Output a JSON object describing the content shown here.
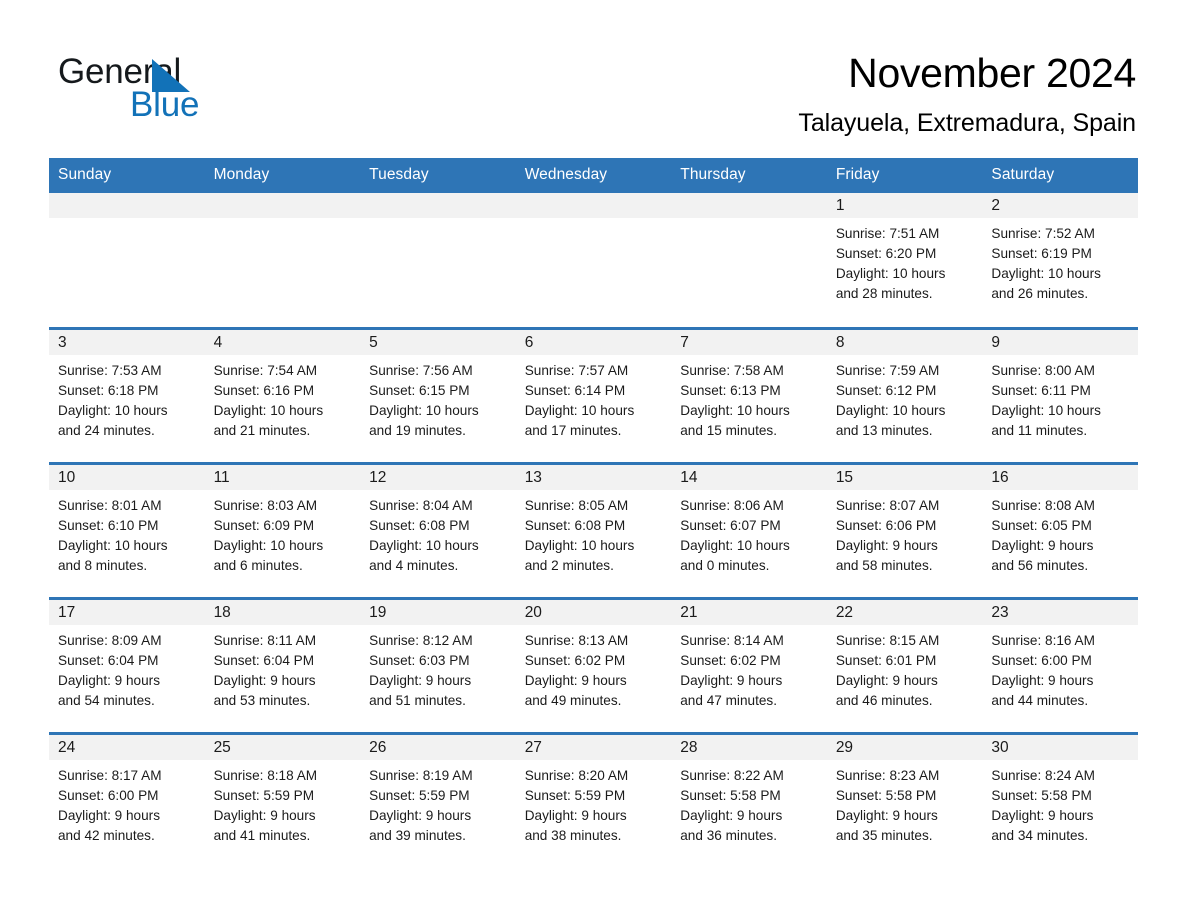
{
  "brand": {
    "name_part1": "General",
    "name_part2": "Blue",
    "accent_color": "#1272b8"
  },
  "header": {
    "title": "November 2024",
    "subtitle": "Talayuela, Extremadura, Spain"
  },
  "theme": {
    "header_bg": "#2e75b6",
    "daynum_bg": "#f2f2f2",
    "page_bg": "#ffffff",
    "text": "#1b1b1b"
  },
  "weekdays": [
    "Sunday",
    "Monday",
    "Tuesday",
    "Wednesday",
    "Thursday",
    "Friday",
    "Saturday"
  ],
  "weeks": [
    [
      {
        "day": "",
        "sunrise": "",
        "sunset": "",
        "daylight1": "",
        "daylight2": ""
      },
      {
        "day": "",
        "sunrise": "",
        "sunset": "",
        "daylight1": "",
        "daylight2": ""
      },
      {
        "day": "",
        "sunrise": "",
        "sunset": "",
        "daylight1": "",
        "daylight2": ""
      },
      {
        "day": "",
        "sunrise": "",
        "sunset": "",
        "daylight1": "",
        "daylight2": ""
      },
      {
        "day": "",
        "sunrise": "",
        "sunset": "",
        "daylight1": "",
        "daylight2": ""
      },
      {
        "day": "1",
        "sunrise": "Sunrise: 7:51 AM",
        "sunset": "Sunset: 6:20 PM",
        "daylight1": "Daylight: 10 hours",
        "daylight2": "and 28 minutes."
      },
      {
        "day": "2",
        "sunrise": "Sunrise: 7:52 AM",
        "sunset": "Sunset: 6:19 PM",
        "daylight1": "Daylight: 10 hours",
        "daylight2": "and 26 minutes."
      }
    ],
    [
      {
        "day": "3",
        "sunrise": "Sunrise: 7:53 AM",
        "sunset": "Sunset: 6:18 PM",
        "daylight1": "Daylight: 10 hours",
        "daylight2": "and 24 minutes."
      },
      {
        "day": "4",
        "sunrise": "Sunrise: 7:54 AM",
        "sunset": "Sunset: 6:16 PM",
        "daylight1": "Daylight: 10 hours",
        "daylight2": "and 21 minutes."
      },
      {
        "day": "5",
        "sunrise": "Sunrise: 7:56 AM",
        "sunset": "Sunset: 6:15 PM",
        "daylight1": "Daylight: 10 hours",
        "daylight2": "and 19 minutes."
      },
      {
        "day": "6",
        "sunrise": "Sunrise: 7:57 AM",
        "sunset": "Sunset: 6:14 PM",
        "daylight1": "Daylight: 10 hours",
        "daylight2": "and 17 minutes."
      },
      {
        "day": "7",
        "sunrise": "Sunrise: 7:58 AM",
        "sunset": "Sunset: 6:13 PM",
        "daylight1": "Daylight: 10 hours",
        "daylight2": "and 15 minutes."
      },
      {
        "day": "8",
        "sunrise": "Sunrise: 7:59 AM",
        "sunset": "Sunset: 6:12 PM",
        "daylight1": "Daylight: 10 hours",
        "daylight2": "and 13 minutes."
      },
      {
        "day": "9",
        "sunrise": "Sunrise: 8:00 AM",
        "sunset": "Sunset: 6:11 PM",
        "daylight1": "Daylight: 10 hours",
        "daylight2": "and 11 minutes."
      }
    ],
    [
      {
        "day": "10",
        "sunrise": "Sunrise: 8:01 AM",
        "sunset": "Sunset: 6:10 PM",
        "daylight1": "Daylight: 10 hours",
        "daylight2": "and 8 minutes."
      },
      {
        "day": "11",
        "sunrise": "Sunrise: 8:03 AM",
        "sunset": "Sunset: 6:09 PM",
        "daylight1": "Daylight: 10 hours",
        "daylight2": "and 6 minutes."
      },
      {
        "day": "12",
        "sunrise": "Sunrise: 8:04 AM",
        "sunset": "Sunset: 6:08 PM",
        "daylight1": "Daylight: 10 hours",
        "daylight2": "and 4 minutes."
      },
      {
        "day": "13",
        "sunrise": "Sunrise: 8:05 AM",
        "sunset": "Sunset: 6:08 PM",
        "daylight1": "Daylight: 10 hours",
        "daylight2": "and 2 minutes."
      },
      {
        "day": "14",
        "sunrise": "Sunrise: 8:06 AM",
        "sunset": "Sunset: 6:07 PM",
        "daylight1": "Daylight: 10 hours",
        "daylight2": "and 0 minutes."
      },
      {
        "day": "15",
        "sunrise": "Sunrise: 8:07 AM",
        "sunset": "Sunset: 6:06 PM",
        "daylight1": "Daylight: 9 hours",
        "daylight2": "and 58 minutes."
      },
      {
        "day": "16",
        "sunrise": "Sunrise: 8:08 AM",
        "sunset": "Sunset: 6:05 PM",
        "daylight1": "Daylight: 9 hours",
        "daylight2": "and 56 minutes."
      }
    ],
    [
      {
        "day": "17",
        "sunrise": "Sunrise: 8:09 AM",
        "sunset": "Sunset: 6:04 PM",
        "daylight1": "Daylight: 9 hours",
        "daylight2": "and 54 minutes."
      },
      {
        "day": "18",
        "sunrise": "Sunrise: 8:11 AM",
        "sunset": "Sunset: 6:04 PM",
        "daylight1": "Daylight: 9 hours",
        "daylight2": "and 53 minutes."
      },
      {
        "day": "19",
        "sunrise": "Sunrise: 8:12 AM",
        "sunset": "Sunset: 6:03 PM",
        "daylight1": "Daylight: 9 hours",
        "daylight2": "and 51 minutes."
      },
      {
        "day": "20",
        "sunrise": "Sunrise: 8:13 AM",
        "sunset": "Sunset: 6:02 PM",
        "daylight1": "Daylight: 9 hours",
        "daylight2": "and 49 minutes."
      },
      {
        "day": "21",
        "sunrise": "Sunrise: 8:14 AM",
        "sunset": "Sunset: 6:02 PM",
        "daylight1": "Daylight: 9 hours",
        "daylight2": "and 47 minutes."
      },
      {
        "day": "22",
        "sunrise": "Sunrise: 8:15 AM",
        "sunset": "Sunset: 6:01 PM",
        "daylight1": "Daylight: 9 hours",
        "daylight2": "and 46 minutes."
      },
      {
        "day": "23",
        "sunrise": "Sunrise: 8:16 AM",
        "sunset": "Sunset: 6:00 PM",
        "daylight1": "Daylight: 9 hours",
        "daylight2": "and 44 minutes."
      }
    ],
    [
      {
        "day": "24",
        "sunrise": "Sunrise: 8:17 AM",
        "sunset": "Sunset: 6:00 PM",
        "daylight1": "Daylight: 9 hours",
        "daylight2": "and 42 minutes."
      },
      {
        "day": "25",
        "sunrise": "Sunrise: 8:18 AM",
        "sunset": "Sunset: 5:59 PM",
        "daylight1": "Daylight: 9 hours",
        "daylight2": "and 41 minutes."
      },
      {
        "day": "26",
        "sunrise": "Sunrise: 8:19 AM",
        "sunset": "Sunset: 5:59 PM",
        "daylight1": "Daylight: 9 hours",
        "daylight2": "and 39 minutes."
      },
      {
        "day": "27",
        "sunrise": "Sunrise: 8:20 AM",
        "sunset": "Sunset: 5:59 PM",
        "daylight1": "Daylight: 9 hours",
        "daylight2": "and 38 minutes."
      },
      {
        "day": "28",
        "sunrise": "Sunrise: 8:22 AM",
        "sunset": "Sunset: 5:58 PM",
        "daylight1": "Daylight: 9 hours",
        "daylight2": "and 36 minutes."
      },
      {
        "day": "29",
        "sunrise": "Sunrise: 8:23 AM",
        "sunset": "Sunset: 5:58 PM",
        "daylight1": "Daylight: 9 hours",
        "daylight2": "and 35 minutes."
      },
      {
        "day": "30",
        "sunrise": "Sunrise: 8:24 AM",
        "sunset": "Sunset: 5:58 PM",
        "daylight1": "Daylight: 9 hours",
        "daylight2": "and 34 minutes."
      }
    ]
  ]
}
